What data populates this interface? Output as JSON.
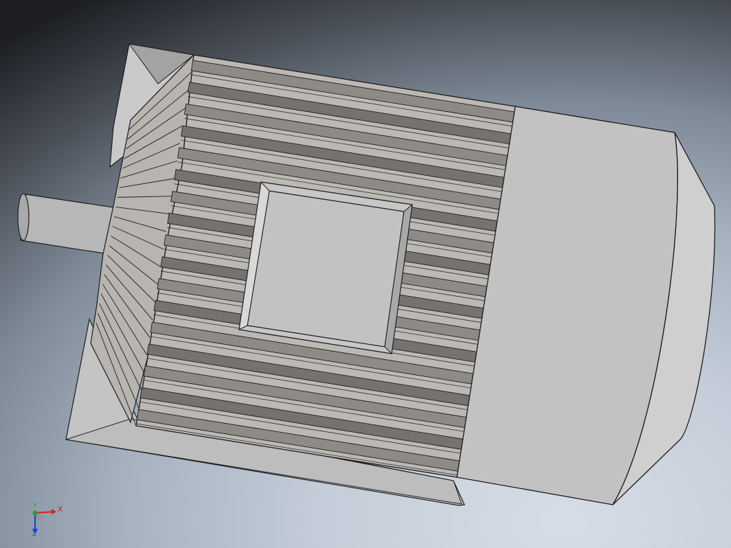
{
  "viewport": {
    "colors": {
      "body": "#bcb8b3",
      "body_shadow": "#8e8b87",
      "fin_groove": "#76736f",
      "end_cap": "#c2c2c2",
      "end_cap_light": "#d0d0d0",
      "edge": "#1a1a1a"
    }
  },
  "triad": {
    "x_label": "X",
    "y_label": "Y",
    "z_label": "Z",
    "colors": {
      "x": "#d42020",
      "y": "#1fa01f",
      "z": "#1f3fcf"
    }
  }
}
